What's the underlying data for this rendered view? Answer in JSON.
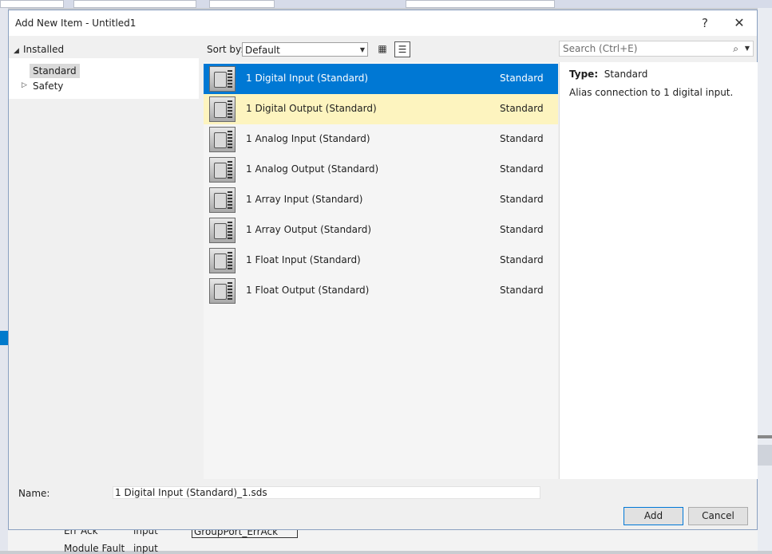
{
  "background": {
    "bottom_row1": [
      "Err Ack",
      "input",
      "GroupPort_ErrAck"
    ],
    "bottom_row2": [
      "Module Fault",
      "input"
    ]
  },
  "dialog": {
    "title": "Add New Item - Untitled1",
    "help_label": "?",
    "close_label": "✕"
  },
  "tree": {
    "header": "Installed",
    "items": [
      {
        "label": "Standard",
        "selected": true
      },
      {
        "label": "Safety",
        "selected": false
      }
    ]
  },
  "toolbar": {
    "sort_label": "Sort by:",
    "sort_value": "Default"
  },
  "search": {
    "placeholder": "Search (Ctrl+E)"
  },
  "items": [
    {
      "name": "1 Digital Input (Standard)",
      "category": "Standard",
      "state": "selected"
    },
    {
      "name": "1 Digital Output (Standard)",
      "category": "Standard",
      "state": "hover"
    },
    {
      "name": "1 Analog Input (Standard)",
      "category": "Standard",
      "state": ""
    },
    {
      "name": "1 Analog Output (Standard)",
      "category": "Standard",
      "state": ""
    },
    {
      "name": "1 Array Input (Standard)",
      "category": "Standard",
      "state": ""
    },
    {
      "name": "1 Array Output (Standard)",
      "category": "Standard",
      "state": ""
    },
    {
      "name": "1 Float Input (Standard)",
      "category": "Standard",
      "state": ""
    },
    {
      "name": "1 Float Output (Standard)",
      "category": "Standard",
      "state": ""
    }
  ],
  "details": {
    "type_label": "Type:",
    "type_value": "Standard",
    "description": "Alias connection to 1 digital input."
  },
  "footer": {
    "name_label": "Name:",
    "name_value": "1 Digital Input (Standard)_1.sds",
    "add_label": "Add",
    "cancel_label": "Cancel"
  },
  "colors": {
    "selection": "#0078d4",
    "hover": "#fdf4bf",
    "default_button_border": "#0078d7"
  }
}
